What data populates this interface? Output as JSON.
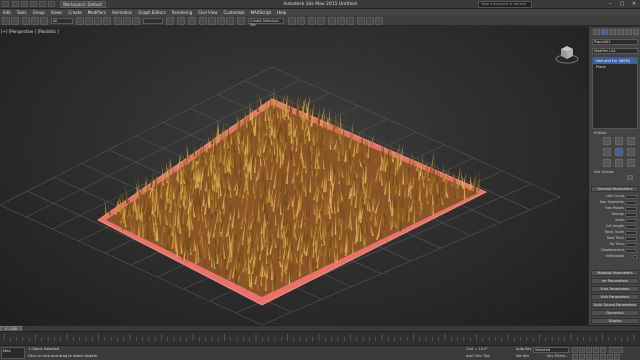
{
  "titlebar": {
    "workspace": "Workspace: Default",
    "title": "Autodesk 3ds Max 2015    Untitled",
    "search_placeholder": "Type a keyword or phrase",
    "minimize": "–",
    "maximize": "□",
    "close": "✕"
  },
  "menubar": {
    "items": [
      "Edit",
      "Tools",
      "Group",
      "Views",
      "Create",
      "Modifiers",
      "Animation",
      "Graph Editors",
      "Rendering",
      "Civil View",
      "Customize",
      "MAXScript",
      "Help"
    ]
  },
  "toolbar": {
    "selection_filter": "All",
    "named_selection": "Create Selection Set"
  },
  "viewport": {
    "label": "[+] [Perspective ] [Realistic ]",
    "view_cube": "view-cube-icon",
    "colors": {
      "plane": "#e8736a",
      "grass_dark": "#6b4a17",
      "grass_light": "#c99a3a",
      "grid": "#555555"
    }
  },
  "command_panel": {
    "object_name": "Plane001",
    "modifier_list": "Modifier List",
    "stack": [
      "Hair and Fur (WSM)",
      "Plane"
    ],
    "utilities_label": "Utilities",
    "hair_groups": "Hair Groups",
    "general_parameters": "General Parameters",
    "params": [
      "Hair Count",
      "Hair Segments",
      "Hair Passes",
      "Density",
      "Scale",
      "Cut Length",
      "Rand. Scale",
      "Root Thick",
      "Tip Thick",
      "Displacement",
      "Interpolate"
    ],
    "rollouts": [
      "Material Parameters",
      "mr Parameters",
      "Frizz Parameters",
      "Kink Parameters",
      "Multi Strand Parameters",
      "Dynamics",
      "Display"
    ]
  },
  "timeline": {
    "current": "0 / 100"
  },
  "statusbar": {
    "maxscript": "MAX",
    "status_top": "1 Object Selected",
    "status_bottom": "Click or click-and-drag to select objects",
    "grid": "Grid = 10.0\"",
    "time_tag": "Add Time Tag",
    "auto_key": "Auto Key",
    "set_key": "Set Key",
    "selected": "Selected",
    "key_filters": "Key Filters..."
  }
}
